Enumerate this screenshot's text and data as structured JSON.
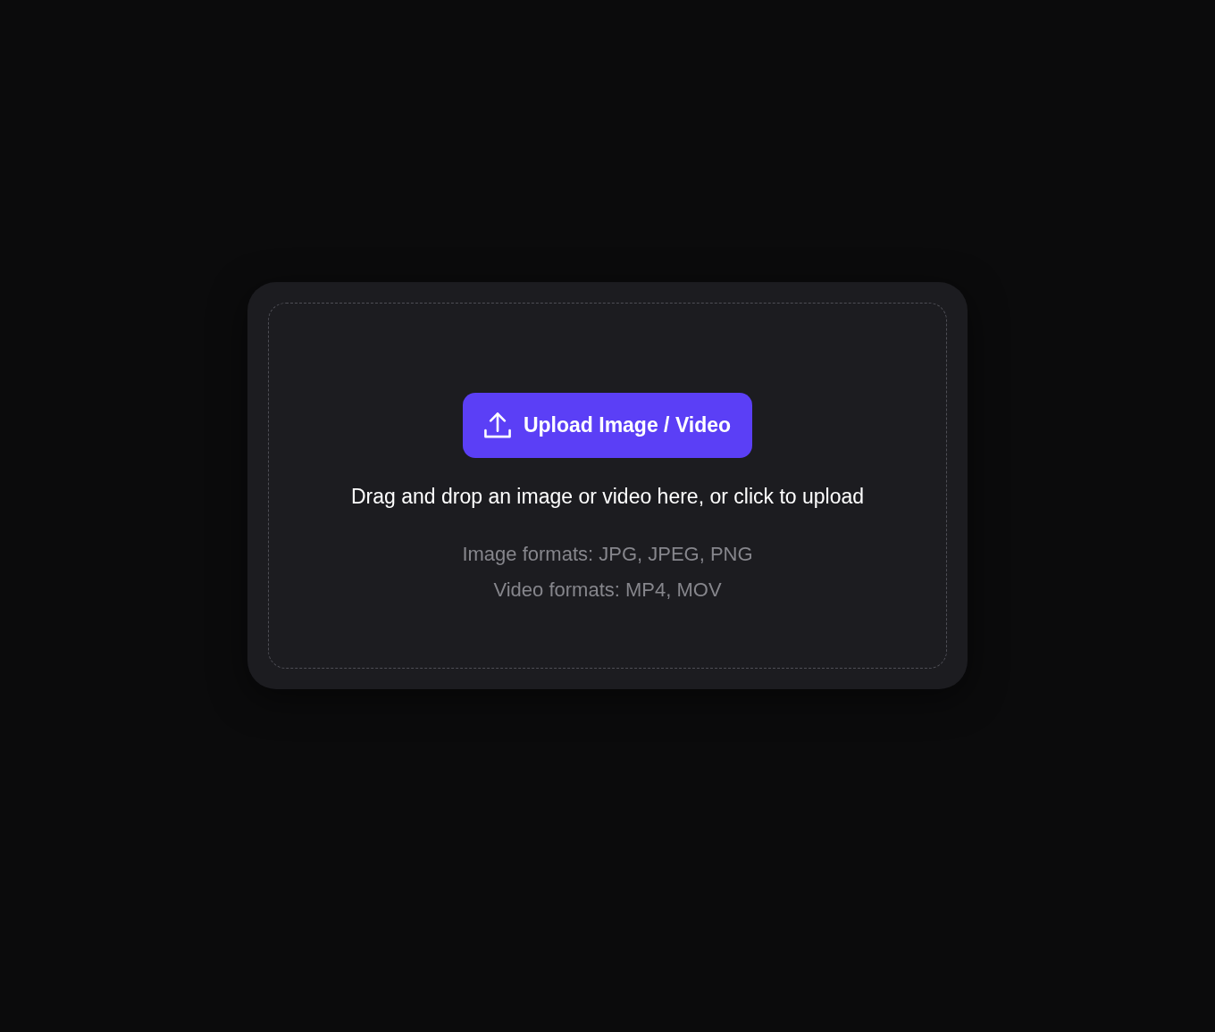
{
  "upload_card": {
    "button": {
      "label": "Upload Image / Video"
    },
    "instruction": "Drag and drop an image or video here, or click to upload",
    "format_notes": [
      "Image formats: JPG, JPEG, PNG",
      "Video formats: MP4, MOV"
    ]
  }
}
